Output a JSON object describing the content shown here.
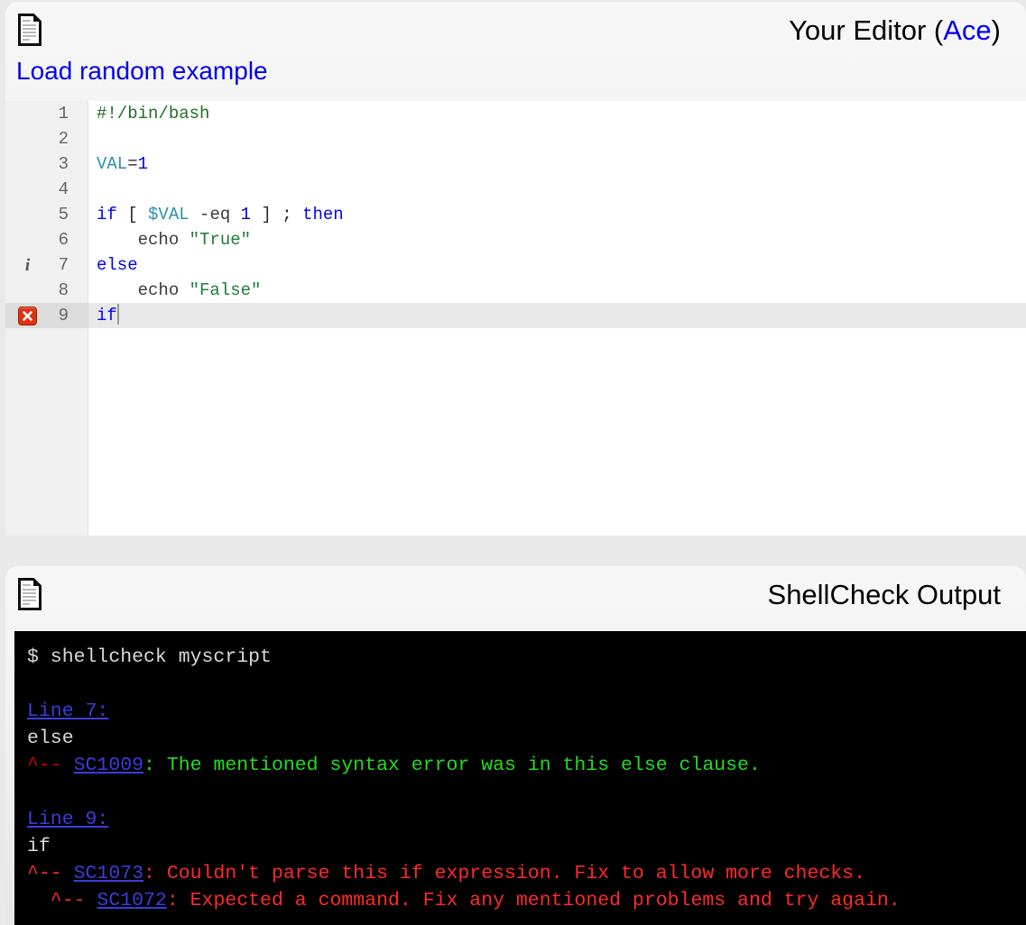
{
  "editor": {
    "icon": "document-icon",
    "title_prefix": "Your Editor (",
    "title_link": "Ace",
    "title_suffix": ")",
    "load_example_label": "Load random example",
    "lines": [
      {
        "n": "1",
        "marker": "",
        "tokens": [
          {
            "t": "comment",
            "v": "#!/bin/bash"
          }
        ]
      },
      {
        "n": "2",
        "marker": "",
        "tokens": []
      },
      {
        "n": "3",
        "marker": "",
        "tokens": [
          {
            "t": "var",
            "v": "VAL"
          },
          {
            "t": "plain",
            "v": "="
          },
          {
            "t": "num",
            "v": "1"
          }
        ]
      },
      {
        "n": "4",
        "marker": "",
        "tokens": []
      },
      {
        "n": "5",
        "marker": "",
        "tokens": [
          {
            "t": "keyword",
            "v": "if"
          },
          {
            "t": "plain",
            "v": " [ "
          },
          {
            "t": "var",
            "v": "$VAL"
          },
          {
            "t": "plain",
            "v": " "
          },
          {
            "t": "ident",
            "v": "-eq"
          },
          {
            "t": "plain",
            "v": " "
          },
          {
            "t": "num",
            "v": "1"
          },
          {
            "t": "plain",
            "v": " ] ; "
          },
          {
            "t": "keyword",
            "v": "then"
          }
        ]
      },
      {
        "n": "6",
        "marker": "",
        "tokens": [
          {
            "t": "plain",
            "v": "    "
          },
          {
            "t": "ident",
            "v": "echo"
          },
          {
            "t": "plain",
            "v": " "
          },
          {
            "t": "string",
            "v": "\"True\""
          }
        ]
      },
      {
        "n": "7",
        "marker": "info",
        "tokens": [
          {
            "t": "keyword",
            "v": "else"
          }
        ]
      },
      {
        "n": "8",
        "marker": "",
        "tokens": [
          {
            "t": "plain",
            "v": "    "
          },
          {
            "t": "ident",
            "v": "echo"
          },
          {
            "t": "plain",
            "v": " "
          },
          {
            "t": "string",
            "v": "\"False\""
          }
        ]
      },
      {
        "n": "9",
        "marker": "error",
        "active": true,
        "cursor": true,
        "tokens": [
          {
            "t": "keyword",
            "v": "if"
          }
        ]
      }
    ],
    "blank_rows": 8
  },
  "output": {
    "icon": "document-icon",
    "title": "ShellCheck Output",
    "terminal_lines": [
      {
        "kind": "prompt",
        "text": "$ shellcheck myscript"
      },
      {
        "kind": "blank",
        "text": ""
      },
      {
        "kind": "line_link",
        "text": "Line 7:"
      },
      {
        "kind": "source",
        "text": "else"
      },
      {
        "kind": "finding",
        "severity": "info",
        "caret": "^-- ",
        "code": "SC1009",
        "message": ": The mentioned syntax error was in this else clause."
      },
      {
        "kind": "blank",
        "text": ""
      },
      {
        "kind": "line_link",
        "text": "Line 9:"
      },
      {
        "kind": "source",
        "text": "if"
      },
      {
        "kind": "finding",
        "severity": "error",
        "caret": "^-- ",
        "code": "SC1073",
        "message": ": Couldn't parse this if expression. Fix to allow more checks."
      },
      {
        "kind": "finding",
        "severity": "error",
        "caret": "  ^-- ",
        "code": "SC1072",
        "message": ": Expected a command. Fix any mentioned problems and try again."
      }
    ]
  },
  "colors": {
    "page_background": "#e9e9e9",
    "panel_gradient_top": "#f7f7f7",
    "panel_gradient_bottom": "#e6e6e6",
    "link_blue": "#0000ee",
    "terminal_background": "#000000",
    "terminal_text": "#d8d8d8",
    "sc_code_link": "#3c3cdb",
    "info_message_green": "#22dd22",
    "error_message_red": "#ff2a2a",
    "error_marker_red": "#dd3311",
    "active_line": "#e8e8e8",
    "gutter_background": "#f0f0f0"
  }
}
